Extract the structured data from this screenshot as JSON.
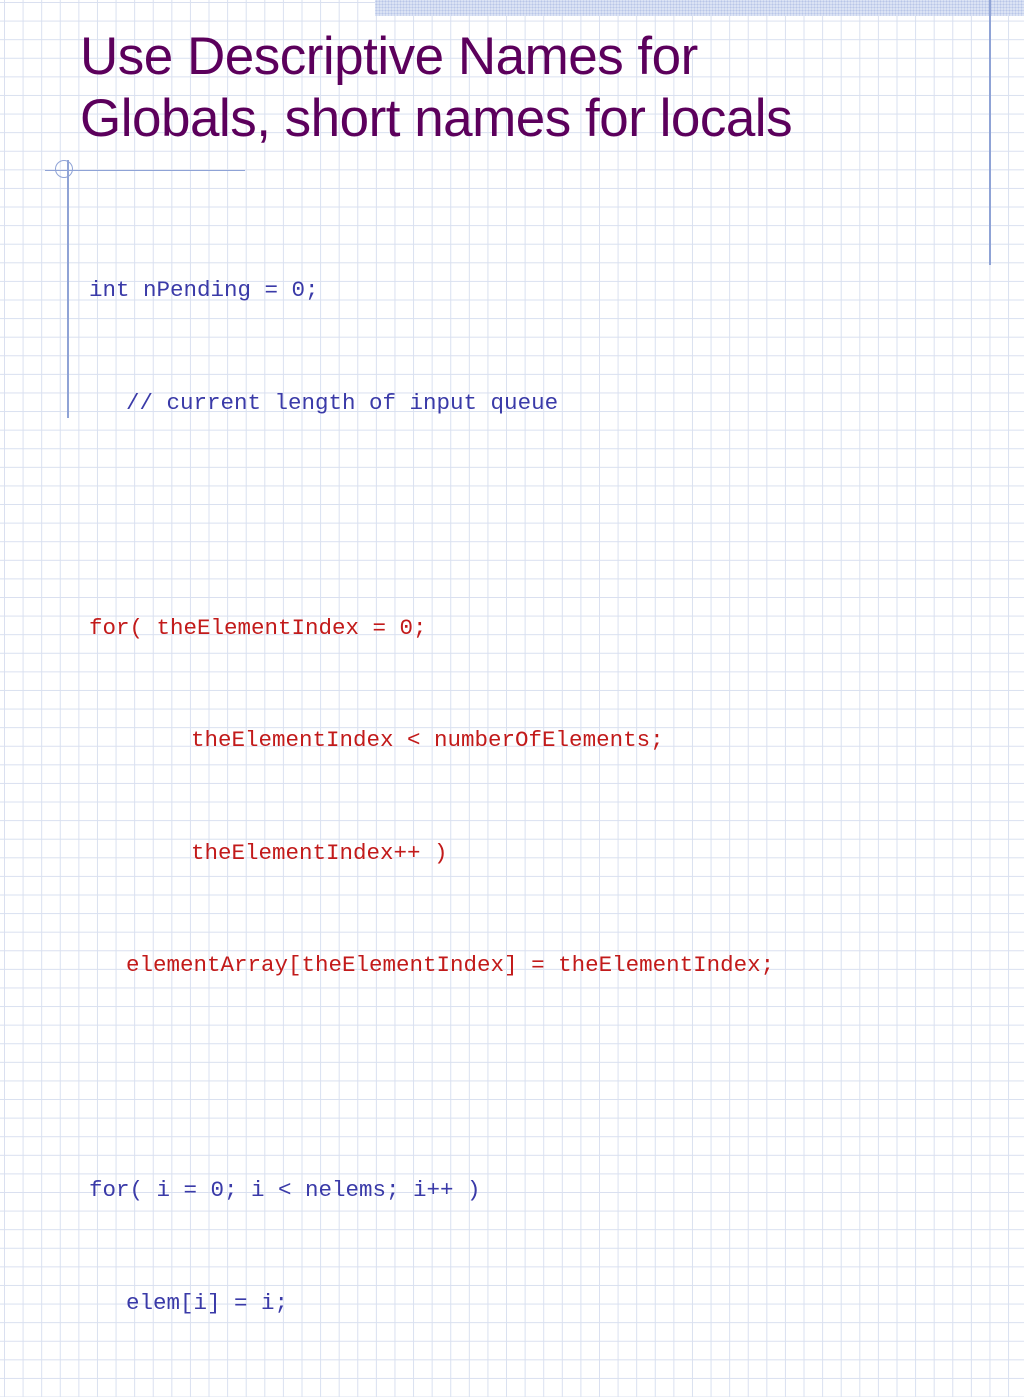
{
  "slide": {
    "title_line1": "Use Descriptive Names for",
    "title_line2": "Globals, short names for locals"
  },
  "code": {
    "block1": {
      "line1": "int nPending = 0;",
      "line2": "// current length of input queue"
    },
    "block2": {
      "line1": "for( theElementIndex = 0;",
      "line2": "theElementIndex < numberOfElements;",
      "line3": "theElementIndex++ )",
      "line4": "elementArray[theElementIndex] = theElementIndex;"
    },
    "block3": {
      "line1": "for( i = 0; i < nelems; i++ )",
      "line2": "elem[i] = i;"
    }
  },
  "colors": {
    "title": "#5c005c",
    "code_blue": "#3a3aa8",
    "code_red": "#c21a1a",
    "grid": "#d9e0f0",
    "accent_rule": "#8fa3d6"
  }
}
